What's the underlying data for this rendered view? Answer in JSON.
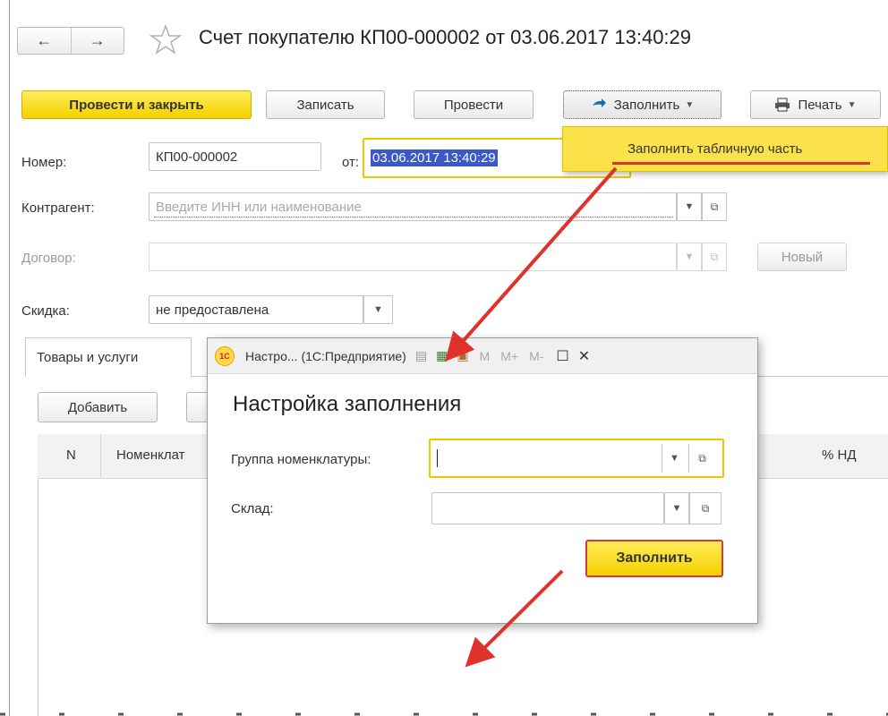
{
  "header": {
    "title": "Счет покупателю КП00-000002 от 03.06.2017 13:40:29"
  },
  "nav": {
    "back": "←",
    "forward": "→"
  },
  "toolbar": {
    "post_close": "Провести и закрыть",
    "save": "Записать",
    "post": "Провести",
    "fill": "Заполнить",
    "print": "Печать"
  },
  "fill_menu": {
    "item": "Заполнить табличную часть"
  },
  "form": {
    "number_label": "Номер:",
    "number_value": "КП00-000002",
    "from_label": "от:",
    "date_value": "03.06.2017 13:40:29",
    "contractor_label": "Контрагент:",
    "contractor_placeholder": "Введите ИНН или наименование",
    "contract_label": "Договор:",
    "new_button": "Новый",
    "discount_label": "Скидка:",
    "discount_value": "не предоставлена"
  },
  "tabs": {
    "goods": "Товары и услуги"
  },
  "table": {
    "add_button": "Добавить",
    "col_n": "N",
    "col_nomenclature": "Номенклат",
    "col_vat": "% НД"
  },
  "popup": {
    "window_title": "Настро... (1С:Предприятие)",
    "logo_text": "1С",
    "toolbar_m": "M",
    "toolbar_mplus": "M+",
    "toolbar_mminus": "M-",
    "heading": "Настройка заполнения",
    "group_label": "Группа номенклатуры:",
    "warehouse_label": "Склад:",
    "fill_button": "Заполнить"
  },
  "colors": {
    "accent_yellow": "#f4d100",
    "highlight_yellow": "#fbe24b",
    "selection_blue": "#3a58c7",
    "annotation_red": "#e0322a"
  }
}
